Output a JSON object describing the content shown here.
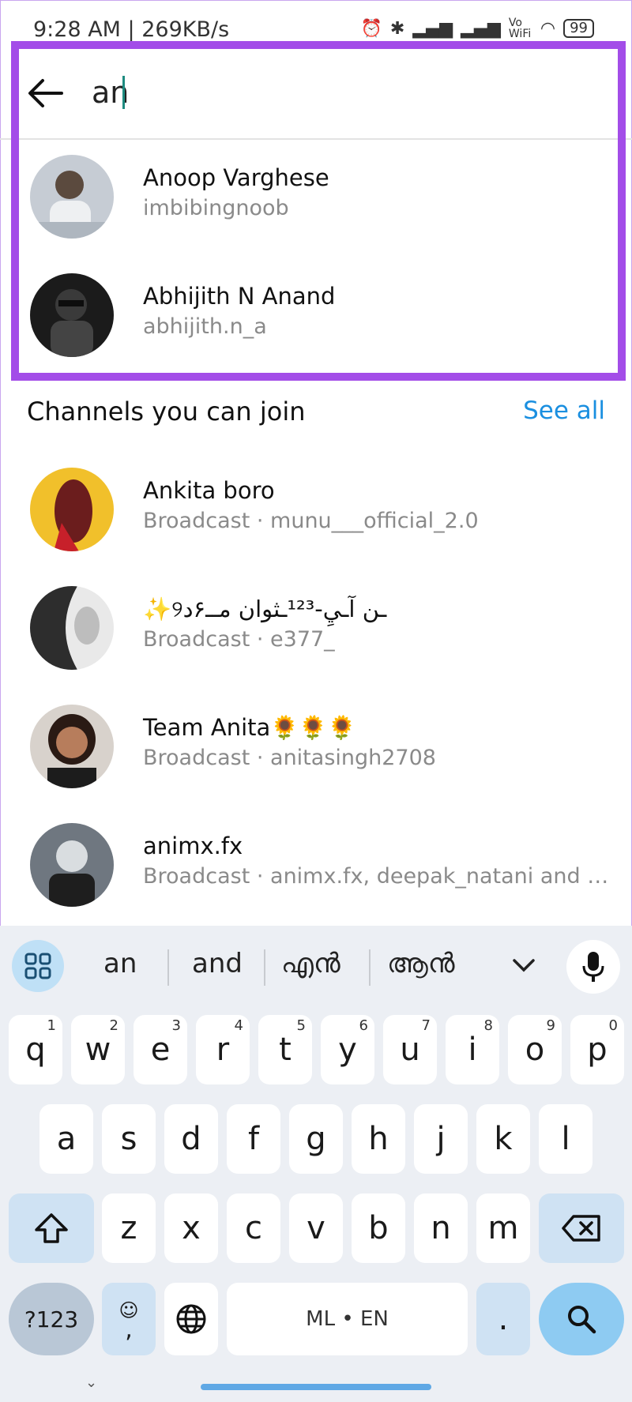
{
  "status": {
    "time": "9:28 AM | 269KB/s",
    "network": "Vo WiFi",
    "battery": "99"
  },
  "search": {
    "value": "an"
  },
  "results": [
    {
      "name": "Anoop Varghese",
      "username": "imbibingnoob"
    },
    {
      "name": "Abhijith N Anand",
      "username": "abhijith.n_a"
    }
  ],
  "channels": {
    "title": "Channels you can join",
    "see_all": "See all",
    "items": [
      {
        "name": "Ankita boro",
        "sub": "Broadcast · munu___official_2.0"
      },
      {
        "name": "✨୨ـن آـيِ-¹²³ـثوان مــ۶د",
        "sub": "Broadcast · e377_"
      },
      {
        "name": "Team Anita🌻🌻🌻",
        "sub": "Broadcast · anitasingh2708"
      },
      {
        "name": "animx.fx",
        "sub": "Broadcast · animx.fx, deepak_natani and 1 o..."
      }
    ]
  },
  "keyboard": {
    "suggestions": [
      "an",
      "and",
      "എൻ",
      "ആൻ"
    ],
    "row1": [
      "q",
      "w",
      "e",
      "r",
      "t",
      "y",
      "u",
      "i",
      "o",
      "p"
    ],
    "row1_hints": [
      "1",
      "2",
      "3",
      "4",
      "5",
      "6",
      "7",
      "8",
      "9",
      "0"
    ],
    "row2": [
      "a",
      "s",
      "d",
      "f",
      "g",
      "h",
      "j",
      "k",
      "l"
    ],
    "row3": [
      "z",
      "x",
      "c",
      "v",
      "b",
      "n",
      "m"
    ],
    "symbols_label": "?123",
    "emoji_label": "☺",
    "comma_label": ",",
    "space_label": "ML • EN",
    "period_label": "."
  },
  "colors": {
    "highlight": "#a34de8",
    "link": "#1a8fe0",
    "key_mod": "#cfe2f3"
  }
}
